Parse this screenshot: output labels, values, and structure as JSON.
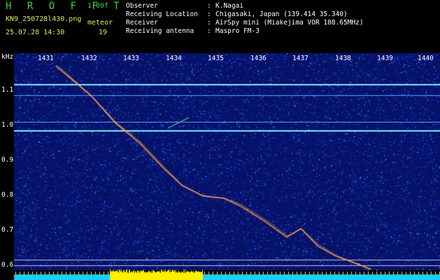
{
  "header": {
    "app_name": "H R O F F T",
    "version": "1.00f",
    "filename": "KN9_250728l430.png",
    "meteor_label": "meteor",
    "datetime": "25.07.28 14:30",
    "count": "19"
  },
  "info": [
    {
      "label": "Observer",
      "sep": ":",
      "value": "K.Nagai"
    },
    {
      "label": "Receiving Location",
      "sep": ":",
      "value": "Chigasaki, Japan (139.414 35.340)"
    },
    {
      "label": "Receiver",
      "sep": ":",
      "value": "AirSpy mini (Miakejima VOR 108.65MHz)"
    },
    {
      "label": "Receiving antenna",
      "sep": ":",
      "value": "Maspro FM-3"
    }
  ],
  "axes": {
    "y_unit": "kHz",
    "x_ticks": [
      "1431",
      "1432",
      "1433",
      "1434",
      "1435",
      "1436",
      "1437",
      "1438",
      "1439",
      "1440"
    ],
    "y_ticks": [
      "1.1",
      "1.0",
      "0.9",
      "0.8",
      "0.7",
      "0.6"
    ]
  },
  "colors": {
    "background": "#000000",
    "noise_low": "#0a1a8c",
    "noise_high": "#2e6bff",
    "echo": "#ff8c3a",
    "carrier": "#7fe8ff",
    "audio_bar": "#ffee00",
    "baseline": "#1ecbff",
    "header_green": "#3fd43a",
    "header_yellow": "#e6e65a"
  }
}
